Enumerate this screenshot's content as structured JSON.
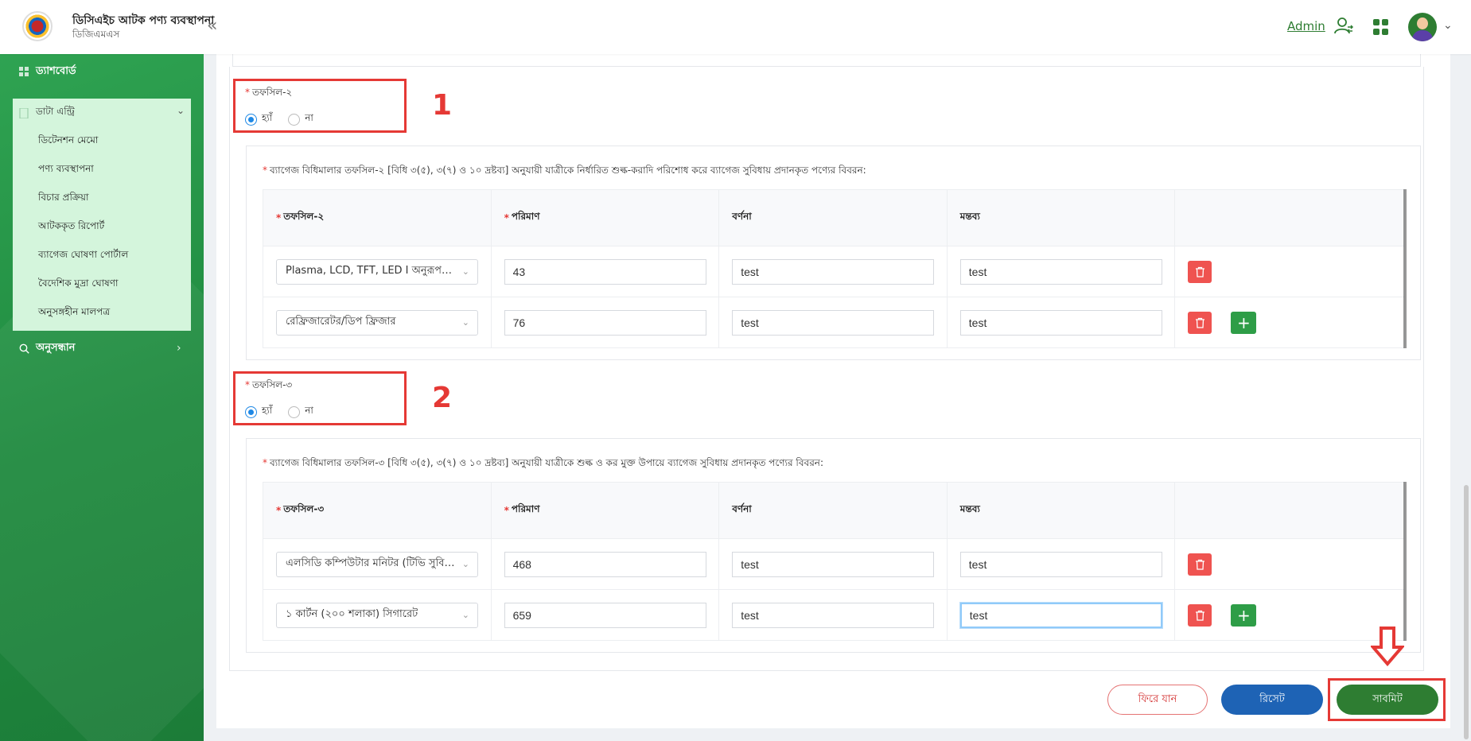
{
  "header": {
    "app_title": "ডিসিএইচ আটক পণ্য ব্যবস্থাপনা",
    "app_subtitle": "ডিজিএমএস",
    "collapse_symbol": "«",
    "admin_label": "Admin"
  },
  "sidebar": {
    "dashboard": "ড্যাশবোর্ড",
    "data_entry": "ডাটা এন্ট্রি",
    "sub_items": [
      "ডিটেনশন মেমো",
      "পণ্য ব্যবস্থাপনা",
      "বিচার প্রক্রিয়া",
      "আটককৃত রিপোর্ট",
      "ব্যাগেজ ঘোষণা পোর্টাল",
      "বৈদেশিক মুদ্রা ঘোষণা",
      "অনুসঙ্গহীন মালপত্র"
    ],
    "search": "অনুসন্ধান"
  },
  "radio": {
    "yes": "হ্যাঁ",
    "no": "না"
  },
  "section2": {
    "label": "তফসিল-২",
    "selected": "হ্যাঁ",
    "badge": "1",
    "description": "ব্যাগেজ বিধিমালার তফসিল-২ [বিধি ৩(৫), ৩(৭) ও ১০ দ্রষ্টব্য] অনুযায়ী যাত্রীকে নির্ধারিত শুল্ক-করাদি পরিশোধ করে ব্যাগেজ সুবিধায় প্রদানকৃত পণ্যের বিবরন:",
    "columns": [
      "তফসিল-২",
      "পরিমাণ",
      "বর্ণনা",
      "মন্তব্য"
    ],
    "rows": [
      {
        "item": "Plasma, LCD, TFT, LED I অনুরূপ প্র...",
        "qty": "43",
        "desc": "test",
        "remark": "test"
      },
      {
        "item": "রেফ্রিজারেটর/ডিপ ফ্রিজার",
        "qty": "76",
        "desc": "test",
        "remark": "test"
      }
    ]
  },
  "section3": {
    "label": "তফসিল-৩",
    "selected": "হ্যাঁ",
    "badge": "2",
    "description": "ব্যাগেজ বিধিমালার তফসিল-৩ [বিধি ৩(৫), ৩(৭) ও ১০ দ্রষ্টব্য] অনুযায়ী যাত্রীকে শুল্ক ও কর মুক্ত উপায়ে ব্যাগেজ সুবিধায় প্রদানকৃত পণ্যের বিবরন:",
    "columns": [
      "তফসিল-৩",
      "পরিমাণ",
      "বর্ণনা",
      "মন্তব্য"
    ],
    "rows": [
      {
        "item": "এলসিডি কম্পিউটার মনিটর (টিভি সুবিধা ...",
        "qty": "468",
        "desc": "test",
        "remark": "test"
      },
      {
        "item": "১ কার্টন (২০০ শলাকা) সিগারেট",
        "qty": "659",
        "desc": "test",
        "remark": "test"
      }
    ]
  },
  "footer": {
    "back": "ফিরে যান",
    "reset": "রিসেট",
    "submit": "সাবমিট"
  },
  "colors": {
    "brand_green": "#2e7d32",
    "annotation_red": "#e53935",
    "reset_blue": "#1e63b5"
  }
}
